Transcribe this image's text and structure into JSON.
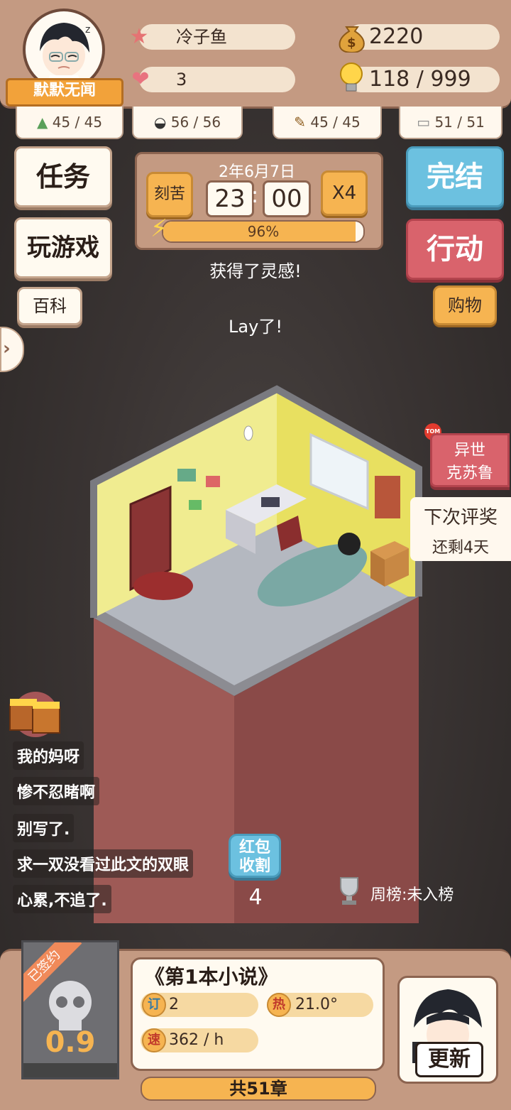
{
  "player": {
    "name": "冷子鱼",
    "title": "默默无闻",
    "hearts": "3"
  },
  "resources": {
    "money": "2220",
    "inspiration": "118 / 999"
  },
  "sub_stats": [
    "45 / 45",
    "56 / 56",
    "45 / 45",
    "51 / 51"
  ],
  "left_buttons": {
    "task": "任务",
    "play": "玩游戏",
    "wiki": "百科"
  },
  "right_buttons": {
    "finish": "完结",
    "action": "行动",
    "shop": "购物"
  },
  "time_panel": {
    "date": "2年6月7日",
    "mode": "刻苦",
    "hour": "23",
    "minute": "00",
    "speed": "X4",
    "energy_label": "96%",
    "energy_value": 0.96
  },
  "messages": [
    "获得了灵感!",
    "Lay了!"
  ],
  "side_tags": {
    "hot_badge": "TOM",
    "book": "异世\n克苏鲁",
    "award_title": "下次评奖",
    "award_days": "还剩4天"
  },
  "comments": [
    "我的妈呀",
    "惨不忍睹啊",
    "别写了.",
    "求一双没看过此文的双眼",
    "心累,不追了."
  ],
  "red_packet": {
    "label": "红包\n收割",
    "count": "4"
  },
  "weekly_rank": "周榜:未入榜",
  "novel": {
    "contract_badge": "已签约",
    "rating": "0.9",
    "title": "《第1本小说》",
    "subs_badge": "订",
    "subs": "2",
    "heat_badge": "热",
    "heat": "21.0°",
    "speed_badge": "速",
    "speed": "362 / h",
    "update_button": "更新",
    "chapters": "共51章"
  },
  "colors": {
    "panel": "#c49a82",
    "orange": "#f6b451",
    "blue": "#6cc1e0",
    "red": "#d9636c"
  }
}
